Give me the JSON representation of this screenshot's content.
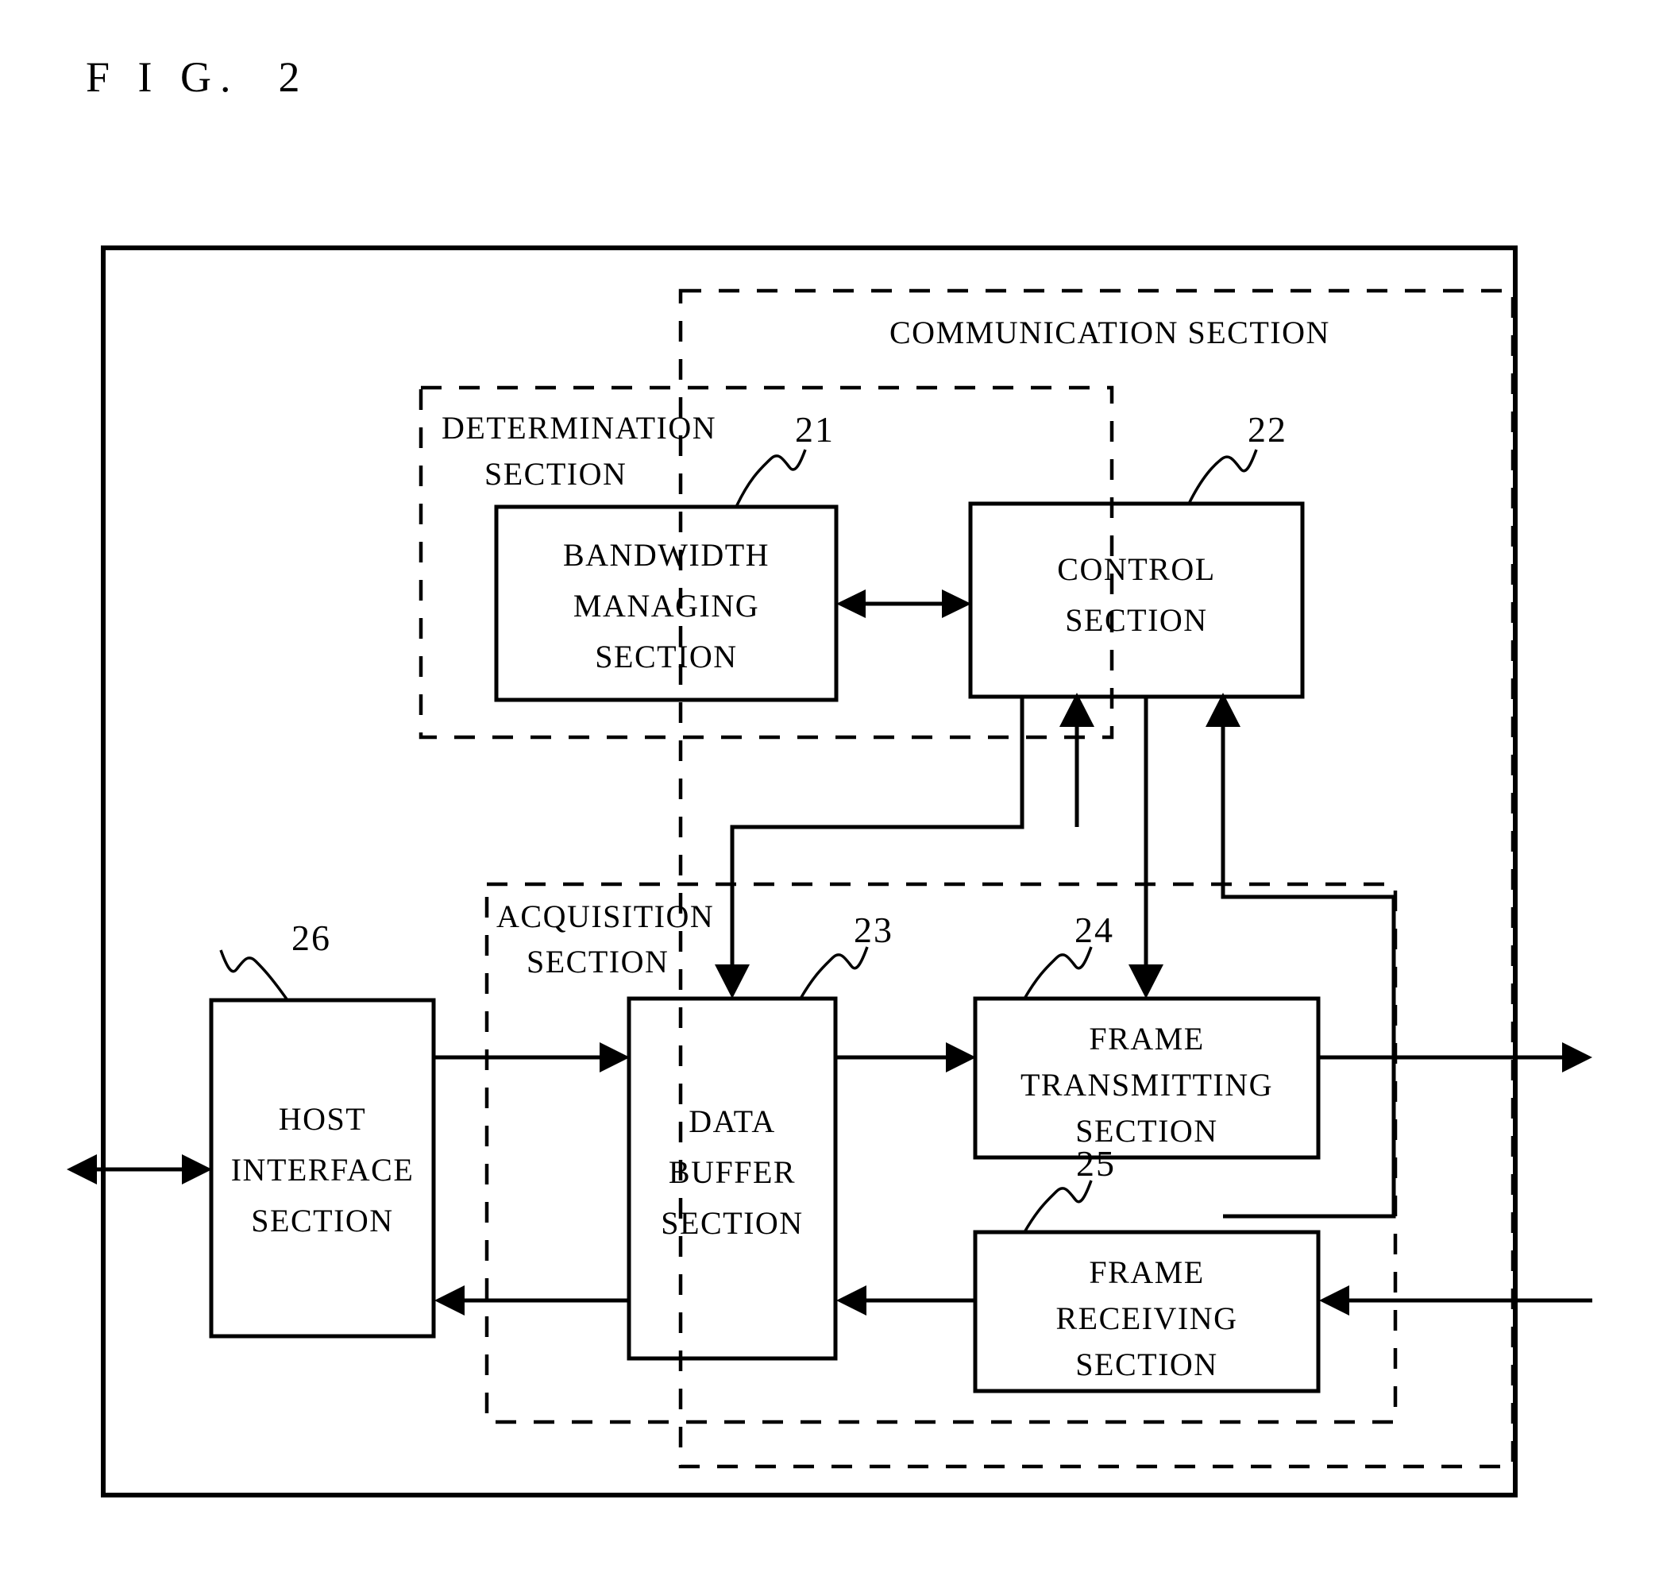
{
  "figure": {
    "title": "F I G.  2"
  },
  "groups": [
    {
      "id": "communication",
      "label": "COMMUNICATION SECTION"
    },
    {
      "id": "determination",
      "label_line1": "DETERMINATION",
      "label_line2": "SECTION"
    },
    {
      "id": "acquisition",
      "label_line1": "ACQUISITION",
      "label_line2": "SECTION"
    }
  ],
  "blocks": [
    {
      "id": "bandwidth-managing-section",
      "ref": "21",
      "lines": [
        "BANDWIDTH",
        "MANAGING",
        "SECTION"
      ]
    },
    {
      "id": "control-section",
      "ref": "22",
      "lines": [
        "CONTROL",
        "SECTION"
      ]
    },
    {
      "id": "data-buffer-section",
      "ref": "23",
      "lines": [
        "DATA",
        "BUFFER",
        "SECTION"
      ]
    },
    {
      "id": "frame-transmitting-section",
      "ref": "24",
      "lines": [
        "FRAME",
        "TRANSMITTING",
        "SECTION"
      ]
    },
    {
      "id": "frame-receiving-section",
      "ref": "25",
      "lines": [
        "FRAME",
        "RECEIVING",
        "SECTION"
      ]
    },
    {
      "id": "host-interface-section",
      "ref": "26",
      "lines": [
        "HOST",
        "INTERFACE",
        "SECTION"
      ]
    }
  ],
  "colors": {
    "ink": "#000000",
    "paper": "#ffffff"
  }
}
